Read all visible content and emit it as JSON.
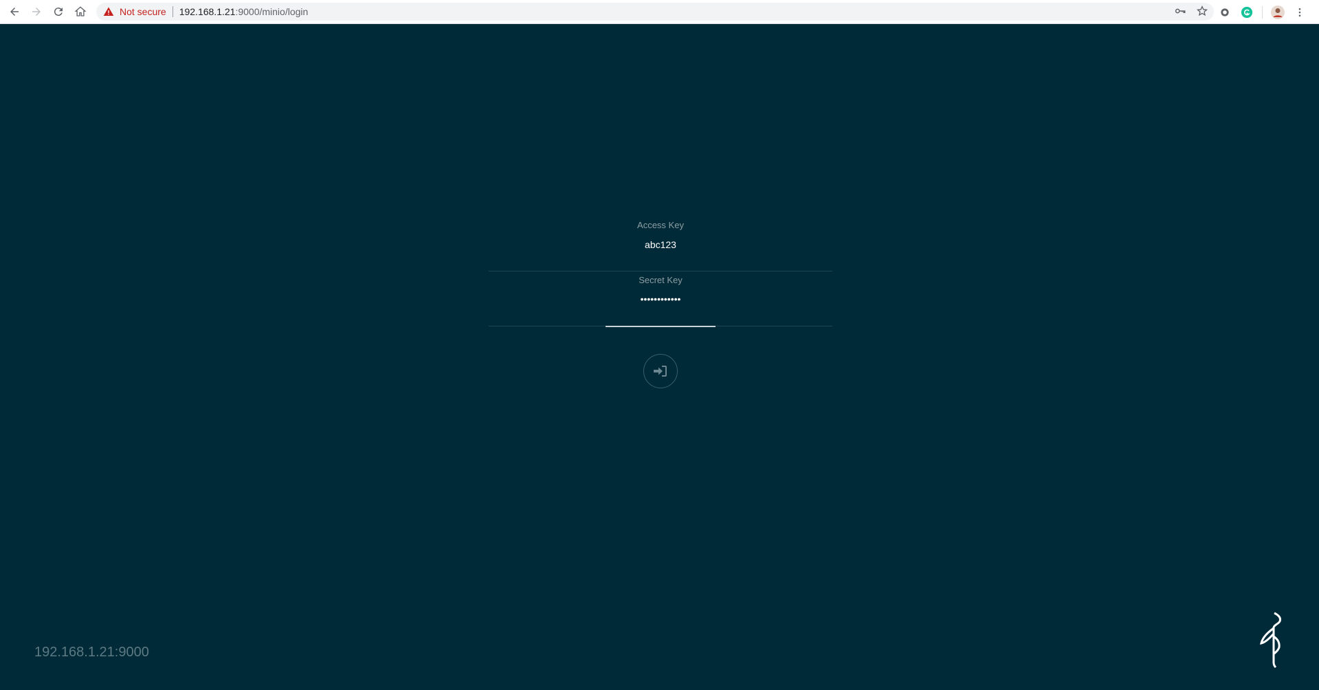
{
  "browser": {
    "security_label": "Not secure",
    "url_host": "192.168.1.21",
    "url_path": ":9000/minio/login"
  },
  "login": {
    "access_key_label": "Access Key",
    "access_key_value": "abc123",
    "secret_key_label": "Secret Key",
    "secret_key_value": "••••••••••••"
  },
  "footer": {
    "host": "192.168.1.21:9000"
  },
  "colors": {
    "background": "#002a37",
    "accent": "#c9d3d6"
  }
}
